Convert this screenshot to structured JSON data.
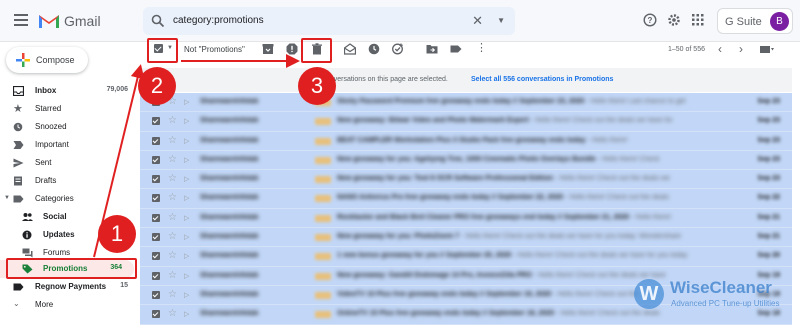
{
  "header": {
    "app_name": "Gmail",
    "search_query": "category:promotions",
    "gsuite_label": "G Suite",
    "avatar_letter": "B"
  },
  "sidebar": {
    "compose_label": "Compose",
    "items": [
      {
        "label": "Inbox",
        "count": "79,006",
        "bold": true
      },
      {
        "label": "Starred",
        "count": ""
      },
      {
        "label": "Snoozed",
        "count": ""
      },
      {
        "label": "Important",
        "count": ""
      },
      {
        "label": "Sent",
        "count": ""
      },
      {
        "label": "Drafts",
        "count": ""
      },
      {
        "label": "Categories",
        "count": ""
      },
      {
        "label": "Social",
        "count": "",
        "bold": true
      },
      {
        "label": "Updates",
        "count": "",
        "bold": true
      },
      {
        "label": "Forums",
        "count": ""
      },
      {
        "label": "Promotions",
        "count": "364",
        "active": true
      },
      {
        "label": "Regnow Payments",
        "count": "15",
        "bold": true
      },
      {
        "label": "More",
        "count": ""
      }
    ]
  },
  "toolbar": {
    "not_promotions_label": "Not \"Promotions\"",
    "pager": "1–50 of 556"
  },
  "banner": {
    "text": "onversations on this page are selected.",
    "link": "Select all 556 conversations in Promotions"
  },
  "rows": [
    {
      "sender": "Sharewarelnfolab",
      "subject": "Sticky Password Premium free giveaway ends today // September 23, 2020",
      "snippet": " - Hello there! Last chance to get",
      "date": "Sep 23"
    },
    {
      "sender": "Sharewarelnfolab",
      "subject": "New giveaway: Bitwar Video and Photo Watermark Expert",
      "snippet": " - Hello there! Check out the deals we have for",
      "date": "Sep 23"
    },
    {
      "sender": "Sharewarelnfolab",
      "subject": "BEAT CAMPLER Workstation Plus 3 Studio Pack free giveaway ends today",
      "snippet": " - Hello there!",
      "date": "Sep 23"
    },
    {
      "sender": "Sharewarelnfolab",
      "subject": "New giveaway for you: Ageliying Tree, 1000 Cinematic Photo Overlays Bundle",
      "snippet": " - Hello there! Check",
      "date": "Sep 23"
    },
    {
      "sender": "Sharewarelnfolab",
      "subject": "New giveaway for you: Tool 8 OCR Software Professional Edition",
      "snippet": " - Hello there! Check out the deals we",
      "date": "Sep 23"
    },
    {
      "sender": "Sharewarelnfolab",
      "subject": "NANO Antivirus Pro free giveaway ends today // September 22, 2020",
      "snippet": " - Hello there! Check out the deals",
      "date": "Sep 22"
    },
    {
      "sender": "Sharewarelnfolab",
      "subject": "Rocktastor and Black Bird Cleaner PRO free giveaways end today // September 21, 2020",
      "snippet": " - Hello there!",
      "date": "Sep 21"
    },
    {
      "sender": "Sharewarelnfolab",
      "subject": "New giveaway for you: PhotoZoom 7",
      "snippet": " - Hello there! Check out the deals we have for you today: Wondershare",
      "date": "Sep 21"
    },
    {
      "sender": "Sharewarelnfolab",
      "subject": "1 new bonus giveaway for you // September 20, 2020",
      "snippet": " - Hello there! Check out the deals we have for you today",
      "date": "Sep 20"
    },
    {
      "sender": "Sharewarelnfolab",
      "subject": "New giveaway: Gandill Diskimage 14 Pro, InvoiceZilla PRO",
      "snippet": " - Hello there! Check out the deals we have",
      "date": "Sep 19"
    },
    {
      "sender": "Sharewarelnfolab",
      "subject": "VideoTV 10 Plus free giveaway ends today // September 19, 2020",
      "snippet": " - Hello there! Check out the",
      "date": "Sep 19"
    },
    {
      "sender": "Sharewarelnfolab",
      "subject": "OnlineTV 15 Plus free giveaway ends today // September 18, 2020",
      "snippet": " - Hello there! Check out the deals",
      "date": "Sep 18"
    }
  ],
  "annotations": {
    "step1": "1",
    "step2": "2",
    "step3": "3",
    "color": "#e02020"
  },
  "watermark": {
    "name": "WiseCleaner",
    "tagline": "Advanced PC Tune-up Utilities"
  },
  "colors": {
    "selected_row": "#c2d7f7",
    "active_nav": "#fce8e6",
    "active_text": "#188038",
    "gmail_red": "#ea4335"
  }
}
